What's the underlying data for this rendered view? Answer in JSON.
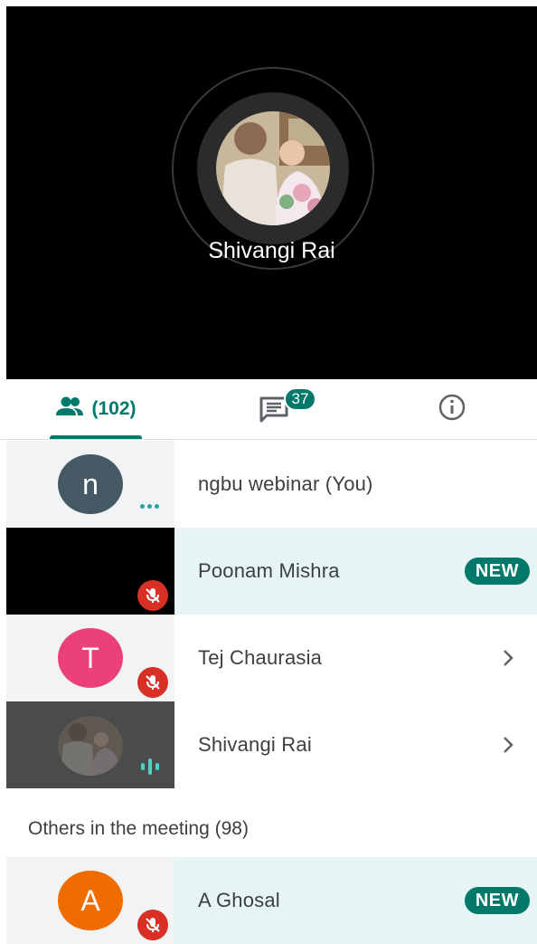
{
  "stage": {
    "speaker_name": "Shivangi Rai"
  },
  "tabs": {
    "people_count": "(102)",
    "chat_badge": "37"
  },
  "participants": [
    {
      "name": "ngbu webinar (You)",
      "avatar_letter": "n",
      "avatar_color": "#455a64"
    },
    {
      "name": "Poonam Mishra",
      "badge": "NEW"
    },
    {
      "name": "Tej Chaurasia",
      "avatar_letter": "T",
      "avatar_color": "#ec407a"
    },
    {
      "name": "Shivangi Rai"
    }
  ],
  "others": {
    "title": "Others in the meeting (98)",
    "items": [
      {
        "name": "A Ghosal",
        "avatar_letter": "A",
        "avatar_color": "#ef6c00",
        "badge": "NEW"
      }
    ]
  },
  "icons": {
    "people": "people-icon",
    "chat": "chat-icon",
    "info": "info-icon",
    "mic_off": "mic-off-icon",
    "more": "more-dots-icon",
    "speaking": "audio-level-icon",
    "chevron": "chevron-right-icon"
  },
  "colors": {
    "accent": "#00796b",
    "new_row_bg": "#e6f5f3",
    "mic_off": "#d93025"
  }
}
